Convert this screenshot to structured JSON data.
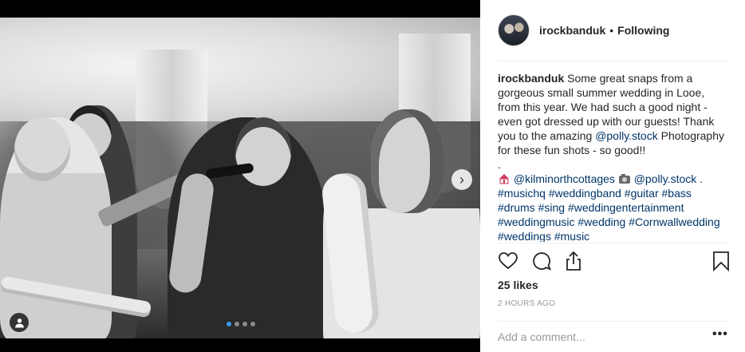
{
  "post": {
    "username": "irockbanduk",
    "separator": "•",
    "follow_status": "Following",
    "caption": {
      "username": "irockbanduk",
      "text_1": "Some great snaps from a gorgeous small summer wedding in Looe, from this year. We had such a good night - even got dressed up with our guests! Thank you to the amazing ",
      "mention_1": "@polly.stock",
      "text_2": " Photography for these fun shots - so good!!",
      "dot_line": ".",
      "mention_2": "@kilminorthcottages",
      "mention_3": "@polly.stock",
      "trailing": " .",
      "hashtags": [
        "#musichq",
        "#weddingband",
        "#guitar",
        "#bass",
        "#drums",
        "#sing",
        "#weddingentertainment",
        "#weddingmusic",
        "#wedding",
        "#Cornwallwedding",
        "#weddings",
        "#music"
      ]
    },
    "likes": "25 likes",
    "timestamp": "2 HOURS AGO",
    "comment_placeholder": "Add a comment...",
    "more_label": "•••"
  },
  "media": {
    "next_label": "›",
    "carousel_total": 4,
    "carousel_active": 0
  },
  "icons": {
    "like": "heart-icon",
    "comment": "comment-icon",
    "share": "share-icon",
    "save": "bookmark-icon",
    "user_tags": "user-icon",
    "next": "chevron-right-icon"
  },
  "colors": {
    "link": "#003569",
    "text": "#262626",
    "muted": "#999999",
    "active_dot": "#3897f0"
  }
}
